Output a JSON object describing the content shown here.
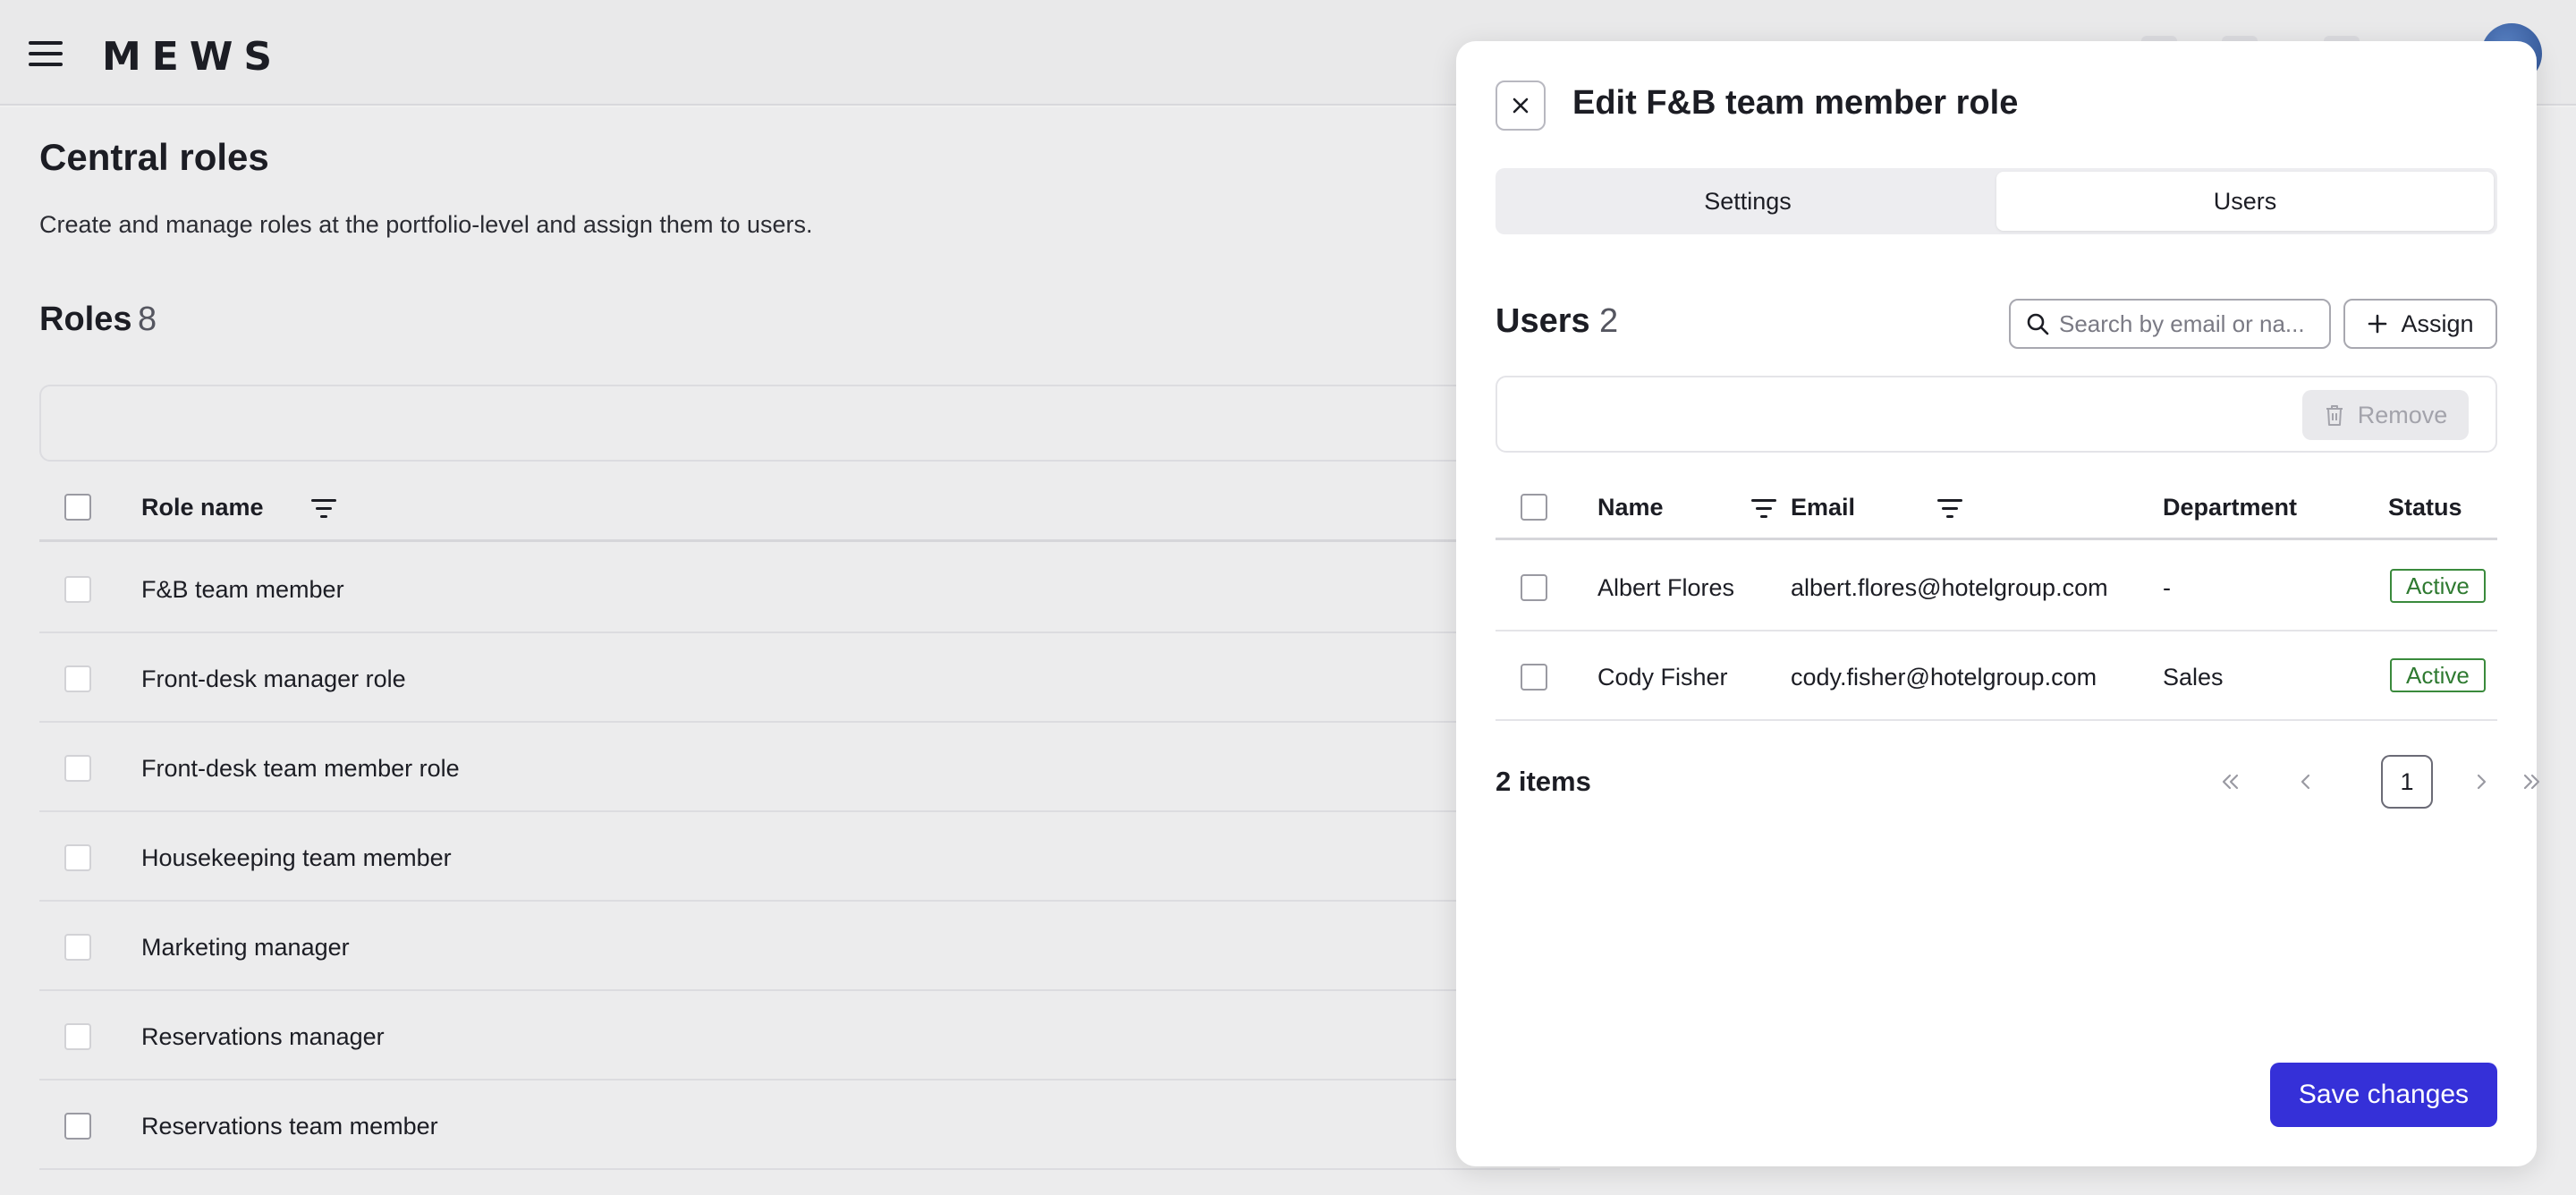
{
  "app": {
    "logo": "MEWS"
  },
  "page": {
    "title": "Central roles",
    "subtitle": "Create and manage roles at the portfolio-level and assign them to users."
  },
  "roles": {
    "heading": "Roles",
    "count": "8",
    "column_role_name": "Role name",
    "items": [
      {
        "name": "F&B team member"
      },
      {
        "name": "Front-desk manager role"
      },
      {
        "name": "Front-desk team member role"
      },
      {
        "name": "Housekeeping team member"
      },
      {
        "name": "Marketing manager"
      },
      {
        "name": "Reservations manager"
      },
      {
        "name": "Reservations team member"
      }
    ]
  },
  "dialog": {
    "title": "Edit F&B team member role",
    "tabs": [
      {
        "label": "Settings",
        "active": false
      },
      {
        "label": "Users",
        "active": true
      }
    ],
    "users_heading": "Users",
    "users_count": "2",
    "search_placeholder": "Search by email or na...",
    "assign_label": "Assign",
    "remove_label": "Remove",
    "columns": {
      "name": "Name",
      "email": "Email",
      "department": "Department",
      "status": "Status"
    },
    "users": [
      {
        "name": "Albert Flores",
        "email": "albert.flores@hotelgroup.com",
        "department": "-",
        "status": "Active"
      },
      {
        "name": "Cody Fisher",
        "email": "cody.fisher@hotelgroup.com",
        "department": "Sales",
        "status": "Active"
      }
    ],
    "items_count": "2 items",
    "pagination": {
      "current_page": "1"
    },
    "save_label": "Save changes"
  },
  "icons": {
    "menu": "hamburger-menu-icon",
    "close": "close-icon",
    "search": "search-icon",
    "plus": "plus-icon",
    "trash": "trash-icon",
    "filter": "filter-icon",
    "first": "chevrons-left-icon",
    "prev": "chevron-left-icon",
    "next": "chevron-right-icon",
    "last": "chevrons-right-icon"
  },
  "colors": {
    "primary": "#3530d8",
    "status_active": "#2f7a31"
  }
}
